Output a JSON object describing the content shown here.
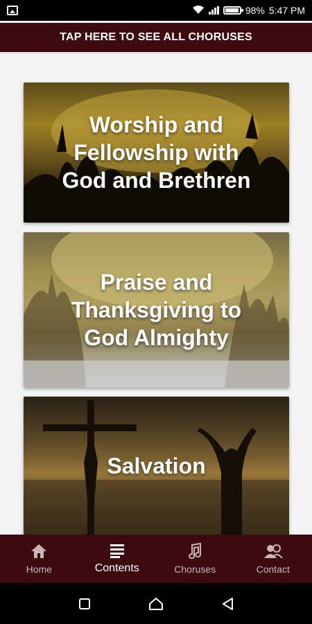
{
  "status_bar": {
    "battery": "98%",
    "time": "5:47 PM"
  },
  "banner": {
    "label": "TAP HERE TO SEE ALL CHORUSES"
  },
  "cards": [
    {
      "title": "Worship and\nFellowship with\nGod and Brethren"
    },
    {
      "title": "Praise and\nThanksgiving to\nGod Almighty"
    },
    {
      "title": "Salvation"
    }
  ],
  "bottom_nav": {
    "items": [
      {
        "label": "Home",
        "icon": "home-icon"
      },
      {
        "label": "Contents",
        "icon": "list-icon",
        "active": true
      },
      {
        "label": "Choruses",
        "icon": "music-note-icon"
      },
      {
        "label": "Contact",
        "icon": "contacts-icon"
      }
    ]
  },
  "colors": {
    "primary": "#3d0a0f",
    "inactive_nav": "#c8b6b8",
    "background": "#f3f3f3"
  }
}
